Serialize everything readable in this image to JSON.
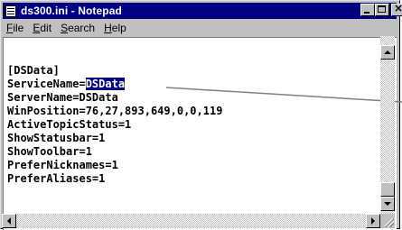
{
  "window": {
    "title": "ds300.ini - Notepad",
    "icons": {
      "app": "notepad-icon",
      "minimize": "minimize-icon",
      "maximize": "maximize-icon",
      "close": "close-icon"
    },
    "close_glyph": "×"
  },
  "menu": {
    "items": [
      {
        "accel": "F",
        "rest": "ile"
      },
      {
        "accel": "E",
        "rest": "dit"
      },
      {
        "accel": "S",
        "rest": "earch"
      },
      {
        "accel": "H",
        "rest": "elp"
      }
    ]
  },
  "document": {
    "lines": [
      "",
      "[DSData]",
      "ServiceName=",
      "ServerName=DSData",
      "WinPosition=76,27,893,649,0,0,119",
      "ActiveTopicStatus=1",
      "ShowStatusbar=1",
      "ShowToolbar=1",
      "PreferNicknames=1",
      "PreferAliases=1"
    ],
    "selected_text": "DSData"
  },
  "colors": {
    "titlebar": "#000080",
    "selection": "#000080",
    "chrome": "#c0c0c0",
    "callout_line": "#808080"
  }
}
